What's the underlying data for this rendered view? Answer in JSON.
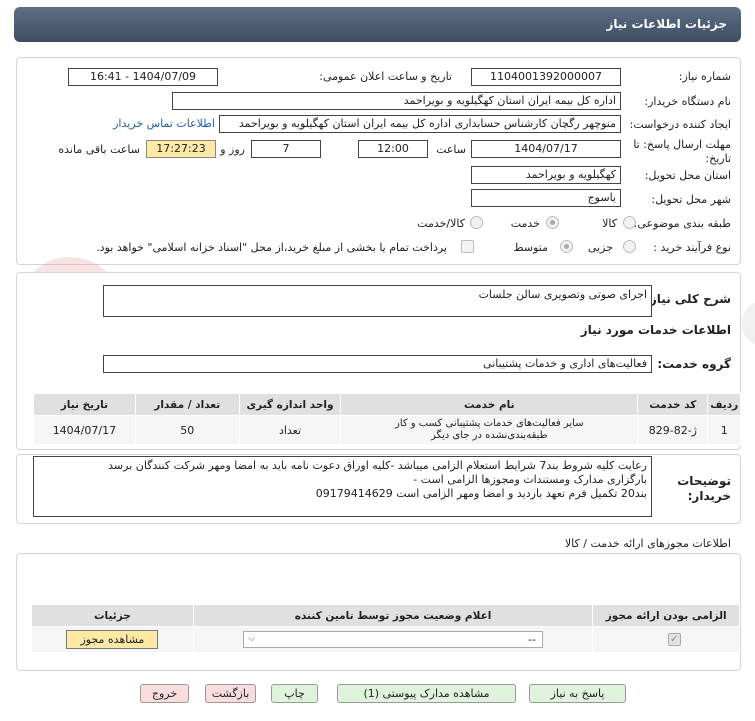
{
  "header": {
    "title": "جزئیات اطلاعات نیاز"
  },
  "fields": {
    "need_number_label": "شماره نیاز:",
    "need_number": "1104001392000007",
    "announce_label": "تاریخ و ساعت اعلان عمومی:",
    "announce_value": "1404/07/09 - 16:41",
    "buyer_org_label": "نام دستگاه خریدار:",
    "buyer_org": "اداره کل بیمه ایران استان کهگیلویه و بویراحمد",
    "creator_label": "ایجاد کننده درخواست:",
    "creator": "منوچهر رگچان کارشناس حسابداری اداره کل بیمه ایران استان کهگیلویه و بویراحمد",
    "contact_link": "اطلاعات تماس خریدار",
    "deadline_label_1": "مهلت ارسال پاسخ: تا",
    "deadline_label_2": "تاریخ:",
    "deadline_date": "1404/07/17",
    "time_label": "ساعت",
    "deadline_time": "12:00",
    "days_value": "7",
    "days_label": "روز و",
    "remaining_time": "17:27:23",
    "remaining_label": "ساعت باقی مانده",
    "province_label": "استان محل تحویل:",
    "province": "کهگیلویه و بویراحمد",
    "city_label": "شهر محل تحویل:",
    "city": "یاسوج",
    "category_label": "طبقه بندی موضوعی:",
    "category_options": [
      "کالا",
      "خدمت",
      "کالا/خدمت"
    ],
    "process_label": "نوع فرآیند خرید :",
    "process_options": [
      "جزیی",
      "متوسط"
    ],
    "payment_note": "پرداخت تمام یا بخشی از مبلغ خرید،از محل \"اسناد خزانه اسلامی\" خواهد بود."
  },
  "summary": {
    "label": "شرح کلی نیاز:",
    "value": "اجرای صوتی وتصویری سالن جلسات"
  },
  "services": {
    "section_title": "اطلاعات خدمات مورد نیاز",
    "group_label": "گروه خدمت:",
    "group_value": "فعالیت‌های اداری و خدمات پشتیبانی",
    "columns": [
      "ردیف",
      "کد خدمت",
      "نام خدمت",
      "واحد اندازه گیری",
      "تعداد / مقدار",
      "تاریخ نیاز"
    ],
    "rows": [
      {
        "index": "1",
        "code": "ژ-82-829",
        "name_line1": "سایر فعالیت‌های خدمات پشتیبانی کسب و کار",
        "name_line2": "طبقه‌بندی‌نشده در جای دیگر",
        "unit": "تعداد",
        "qty": "50",
        "date": "1404/07/17"
      }
    ]
  },
  "buyer_notes": {
    "label_1": "توضیحات",
    "label_2": "خریدار:",
    "line1": "رعایت کلیه شروط بند7 شرایط استعلام الزامی میباشد -کلیه اوراق دعوت نامه باید به امضا ومهر شرکت کنندگان برسد",
    "line2": "بارگزاری مدارک ومستندات ومجوزها الزامی است -",
    "line3": "بند20 تکمیل فرم تعهد بازدید و امضا ومهر الزامی است 09179414629"
  },
  "permits": {
    "section_title": "اطلاعات مجوزهای ارائه خدمت / کالا",
    "columns": [
      "الزامی بودن ارائه مجوز",
      "اعلام وضعیت مجوز توسط تامین کننده",
      "جزئیات"
    ],
    "select_value": "--",
    "view_button": "مشاهده مجوز"
  },
  "buttons": {
    "reply": "پاسخ به نیاز",
    "attachments": "مشاهده مدارک پیوستی (1)",
    "print": "چاپ",
    "back": "بازگشت",
    "exit": "خروج"
  }
}
